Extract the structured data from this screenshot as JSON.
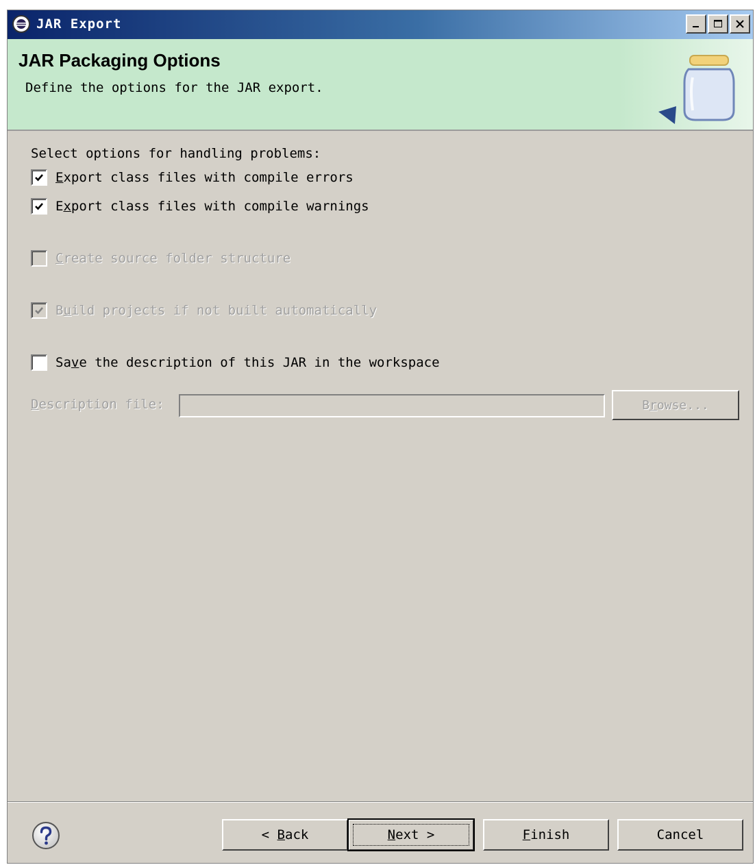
{
  "window": {
    "title": "JAR Export"
  },
  "header": {
    "title": "JAR Packaging Options",
    "description": "Define the options for the JAR export."
  },
  "options": {
    "heading": "Select options for handling problems:",
    "export_errors": {
      "pre": "",
      "mnemonic": "E",
      "post": "xport class files with compile errors",
      "checked": true,
      "enabled": true
    },
    "export_warnings": {
      "pre": "E",
      "mnemonic": "x",
      "post": "port class files with compile warnings",
      "checked": true,
      "enabled": true
    },
    "source_folder": {
      "pre": "",
      "mnemonic": "C",
      "post": "reate source folder structure",
      "checked": false,
      "enabled": false
    },
    "build_projects": {
      "pre": "B",
      "mnemonic": "u",
      "post": "ild projects if not built automatically",
      "checked": true,
      "enabled": false
    },
    "save_description": {
      "pre": "Sa",
      "mnemonic": "v",
      "post": "e the description of this JAR in the workspace",
      "checked": false,
      "enabled": true
    }
  },
  "description_file": {
    "label_mnemonic": "D",
    "label_post": "escription file:",
    "value": "",
    "browse_pre": "B",
    "browse_mnemonic": "r",
    "browse_post": "owse..."
  },
  "footer": {
    "back": {
      "pre": "< ",
      "mnemonic": "B",
      "post": "ack"
    },
    "next": {
      "pre": "",
      "mnemonic": "N",
      "post": "ext >"
    },
    "finish": {
      "pre": "",
      "mnemonic": "F",
      "post": "inish"
    },
    "cancel": "Cancel"
  },
  "colors": {
    "title_bar_start": "#0a246a",
    "header_bg": "#c5e8cc",
    "dialog_bg": "#d4d0c8",
    "disabled_text": "#a0a0a0"
  },
  "icons": {
    "app": "eclipse-icon",
    "banner": "jar-icon",
    "help": "help-icon"
  }
}
